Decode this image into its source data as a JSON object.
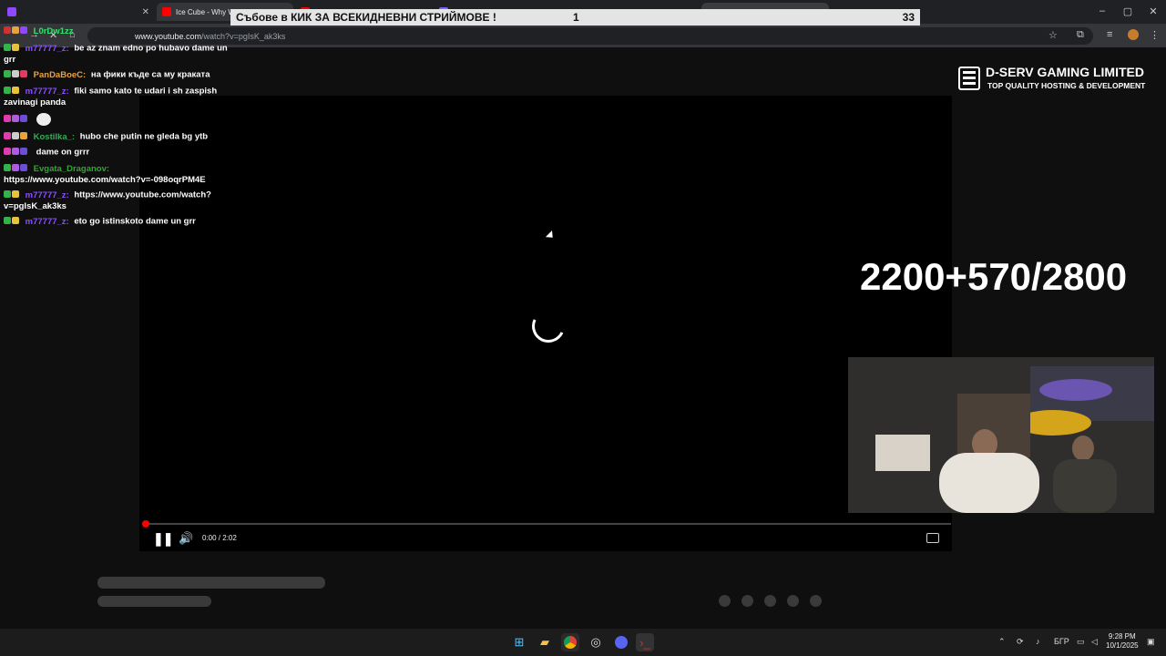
{
  "browser": {
    "tabs": [
      {
        "title": "Ice Cube - Why We Thugs",
        "favicon_color": "#ff0000"
      },
      {
        "title": "",
        "favicon_color": "#ff0000"
      },
      {
        "title": "",
        "favicon_color": "#7b61ff"
      }
    ],
    "url_host": "www.youtube.com",
    "url_path": "/watch?v=pgIsK_ak3ks",
    "window_controls": {
      "minimize": "–",
      "maximize": "▢",
      "close": "✕"
    }
  },
  "overlay": {
    "banner_text": "Събове в КИК ЗА ВСЕКИДНЕВНИ СТРИЙМОВЕ !",
    "banner_count_a": "1",
    "banner_count_b": "33",
    "counter": "2200+570/2800",
    "sponsor_name": "D-SERV GAMING LIMITED",
    "sponsor_tagline": "TOP QUALITY HOSTING & DEVELOPMENT"
  },
  "player": {
    "time": "0:00 / 2:02",
    "progress_fraction": 0.0,
    "state": "loading"
  },
  "chat": {
    "messages": [
      {
        "user": "L0rDw1zz",
        "user_color": "#35e06a",
        "text": ""
      },
      {
        "user": "m77777_z:",
        "user_color": "#8a4fff",
        "text": "be az znam edno po hubavo dame un grr"
      },
      {
        "user": "PanDaBoeC:",
        "user_color": "#e8a33a",
        "text": "на фики къде са му краката"
      },
      {
        "user": "m77777_z:",
        "user_color": "#8a4fff",
        "text": "fiki samo kato te udari i sh zaspish zavinagi panda"
      },
      {
        "user": "",
        "user_color": "#2b47d6",
        "text": ""
      },
      {
        "user": "Kostilka_:",
        "user_color": "#3aa85a",
        "text": "hubo che putin ne gleda bg ytb"
      },
      {
        "user": "",
        "user_color": "#2b47d6",
        "text": "dame on grrr"
      },
      {
        "user": "Evgata_Draganov:",
        "user_color": "#2fa82f",
        "text": "https://www.youtube.com/watch?v=-098oqrPM4E"
      },
      {
        "user": "m77777_z:",
        "user_color": "#8a4fff",
        "text": "https://www.youtube.com/watch?v=pgIsK_ak3ks"
      },
      {
        "user": "m77777_z:",
        "user_color": "#8a4fff",
        "text": "eto go istinskoto dame un grr"
      }
    ]
  },
  "taskbar": {
    "apps": [
      "windows-start",
      "file-explorer",
      "chrome",
      "obs",
      "discord",
      "terminal"
    ],
    "language": "БГР",
    "time": "9:28 PM",
    "date": "10/1/2025"
  }
}
